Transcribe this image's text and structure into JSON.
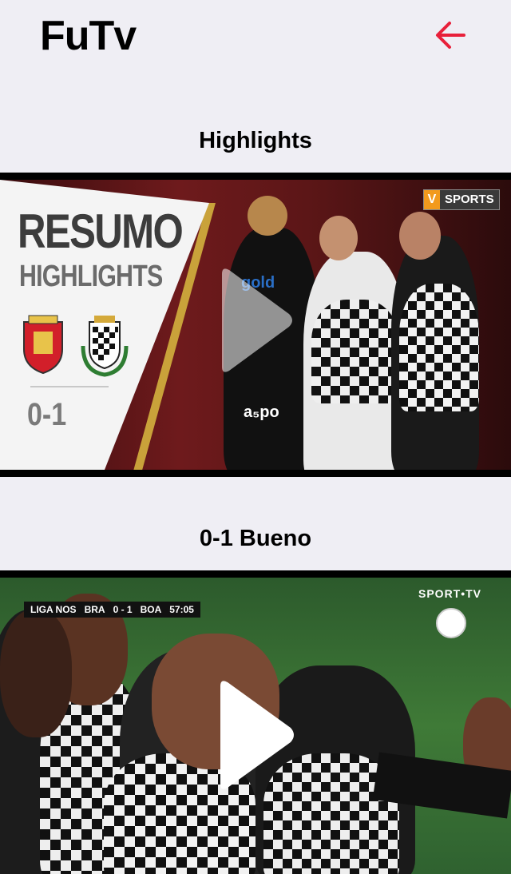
{
  "app": {
    "title": "FuTv"
  },
  "header": {
    "back_icon": "arrow-left-icon",
    "accent": "#e8203a"
  },
  "videos": [
    {
      "title": "Highlights",
      "thumbnail": {
        "heading": "RESUMO",
        "subheading": "HIGHLIGHTS",
        "score": "0-1",
        "channel_badge_letter": "V",
        "channel_badge_text": "SPORTS",
        "sponsor_text": "gold",
        "sponsor_text_2": "a₅po"
      }
    },
    {
      "title": "0-1 Bueno",
      "thumbnail": {
        "league": "LIGA NOS",
        "home": "BRA",
        "score": "0 - 1",
        "away": "BOA",
        "clock": "57:05",
        "channel": "SPORT•TV"
      }
    }
  ],
  "play_icon": "play-icon"
}
